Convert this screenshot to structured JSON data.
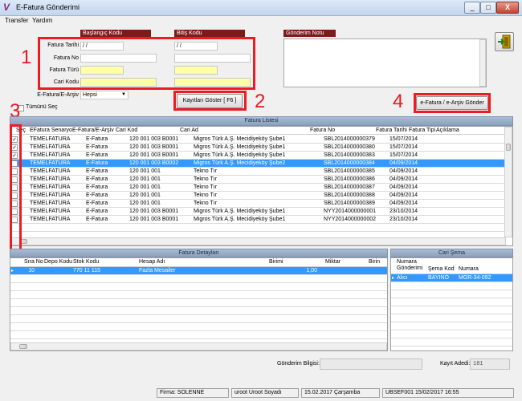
{
  "window": {
    "title": "E-Fatura Gönderimi",
    "controls": [
      "_",
      "□",
      "X"
    ]
  },
  "menu": [
    "Transfer",
    "Yardım"
  ],
  "filters": {
    "start_header": "Başlangıç Kodu",
    "end_header": "Bitiş Kodu",
    "rows": [
      {
        "label": "Fatura Tarihi",
        "start": "  /  /",
        "end": "  /  /"
      },
      {
        "label": "Fatura No",
        "start": "",
        "end": ""
      },
      {
        "label": "Fatura Türü",
        "start": "",
        "end": ""
      },
      {
        "label": "Cari Kodu",
        "start": "",
        "end": ""
      }
    ],
    "archive_label": "E-Fatura/E-Arşiv",
    "archive_value": "Hepsi",
    "select_all": "Tümünü Seç"
  },
  "note": {
    "header": "Gönderim Notu"
  },
  "buttons": {
    "show": "Kayıtları Göster [ F6 ]",
    "send": "e-Fatura / e-Arşiv Gönder"
  },
  "annotations": [
    "1",
    "2",
    "3",
    "4"
  ],
  "invoice_list": {
    "title": "Fatura Listesi",
    "columns": [
      "Seç",
      "EFatura Senaryo",
      "E-Fatura/E-Arşiv",
      "Cari Kod",
      "Cari Ad",
      "Fatura No",
      "Fatura Tarihi",
      "Fatura Tipi",
      "Açıklama"
    ],
    "rows": [
      {
        "checked": "✓",
        "scenario": "TEMELFATURA",
        "type": "E-Fatura",
        "code": "120 001 003 B0001",
        "name": "Migros Türk A.Ş. Mecidiyeköy Şube1",
        "no": "SBL2014000000379",
        "date": "15/07/2014"
      },
      {
        "checked": "✓",
        "scenario": "TEMELFATURA",
        "type": "E-Fatura",
        "code": "120 001 003 B0001",
        "name": "Migros Türk A.Ş. Mecidiyeköy Şube1",
        "no": "SBL2014000000380",
        "date": "15/07/2014"
      },
      {
        "checked": "✓",
        "scenario": "TEMELFATURA",
        "type": "E-Fatura",
        "code": "120 001 003 B0001",
        "name": "Migros Türk A.Ş. Mecidiyeköy Şube1",
        "no": "SBL2014000000383",
        "date": "15/07/2014"
      },
      {
        "checked": "",
        "scenario": "TEMELFATURA",
        "type": "E-Fatura",
        "code": "120 001 003 B0002",
        "name": "Migros Türk A.Ş. Mecidiyeköy Şube2",
        "no": "SBL2014000000384",
        "date": "04/09/2014"
      },
      {
        "checked": "",
        "scenario": "TEMELFATURA",
        "type": "E-Fatura",
        "code": "120 001 001",
        "name": "Tekno Tır",
        "no": "SBL2014000000385",
        "date": "04/09/2014"
      },
      {
        "checked": "",
        "scenario": "TEMELFATURA",
        "type": "E-Fatura",
        "code": "120 001 001",
        "name": "Tekno Tır",
        "no": "SBL2014000000386",
        "date": "04/09/2014"
      },
      {
        "checked": "",
        "scenario": "TEMELFATURA",
        "type": "E-Fatura",
        "code": "120 001 001",
        "name": "Tekno Tır",
        "no": "SBL2014000000387",
        "date": "04/09/2014"
      },
      {
        "checked": "",
        "scenario": "TEMELFATURA",
        "type": "E-Fatura",
        "code": "120 001 001",
        "name": "Tekno Tır",
        "no": "SBL2014000000388",
        "date": "04/09/2014"
      },
      {
        "checked": "",
        "scenario": "TEMELFATURA",
        "type": "E-Fatura",
        "code": "120 001 001",
        "name": "Tekno Tır",
        "no": "SBL2014000000389",
        "date": "04/09/2014"
      },
      {
        "checked": "",
        "scenario": "TEMELFATURA",
        "type": "E-Fatura",
        "code": "120 001 003 B0001",
        "name": "Migros Türk A.Ş. Mecidiyeköy Şube1",
        "no": "NYY2014000000001",
        "date": "23/10/2014"
      },
      {
        "checked": "",
        "scenario": "TEMELFATURA",
        "type": "E-Fatura",
        "code": "120 001 003 B0001",
        "name": "Migros Türk A.Ş. Mecidiyeköy Şube1",
        "no": "NYY2014000000002",
        "date": "23/10/2014"
      }
    ]
  },
  "details": {
    "title": "Fatura Detayları",
    "columns": [
      "Sıra No",
      "Depo Kodu",
      "Stok Kodu",
      "Hesap Adı",
      "Birimi",
      "Miktar",
      "Birin"
    ],
    "rows": [
      {
        "sira": "10",
        "depo": "",
        "stok": "770 11 115",
        "hesap": "Fazla Mesailer",
        "birim": "",
        "miktar": "1,00"
      }
    ]
  },
  "cari": {
    "title": "Cari Şema",
    "columns": [
      "Numara Gönderimi",
      "Şema Kod",
      "Numara"
    ],
    "rows": [
      {
        "gon": "Alıcı",
        "kod": "BAYINO",
        "no": "MGR-34-092"
      }
    ]
  },
  "bottom": {
    "send_info_label": "Gönderim Bilgisi:",
    "count_label": "Kayıt Adedi:",
    "count_value": "181"
  },
  "status": [
    "Firma: SOLENNE",
    "uroot Uroot Soyadı",
    "15.02.2017  Çarşamba",
    "UBSEF001 15/02/2017 16:55"
  ]
}
